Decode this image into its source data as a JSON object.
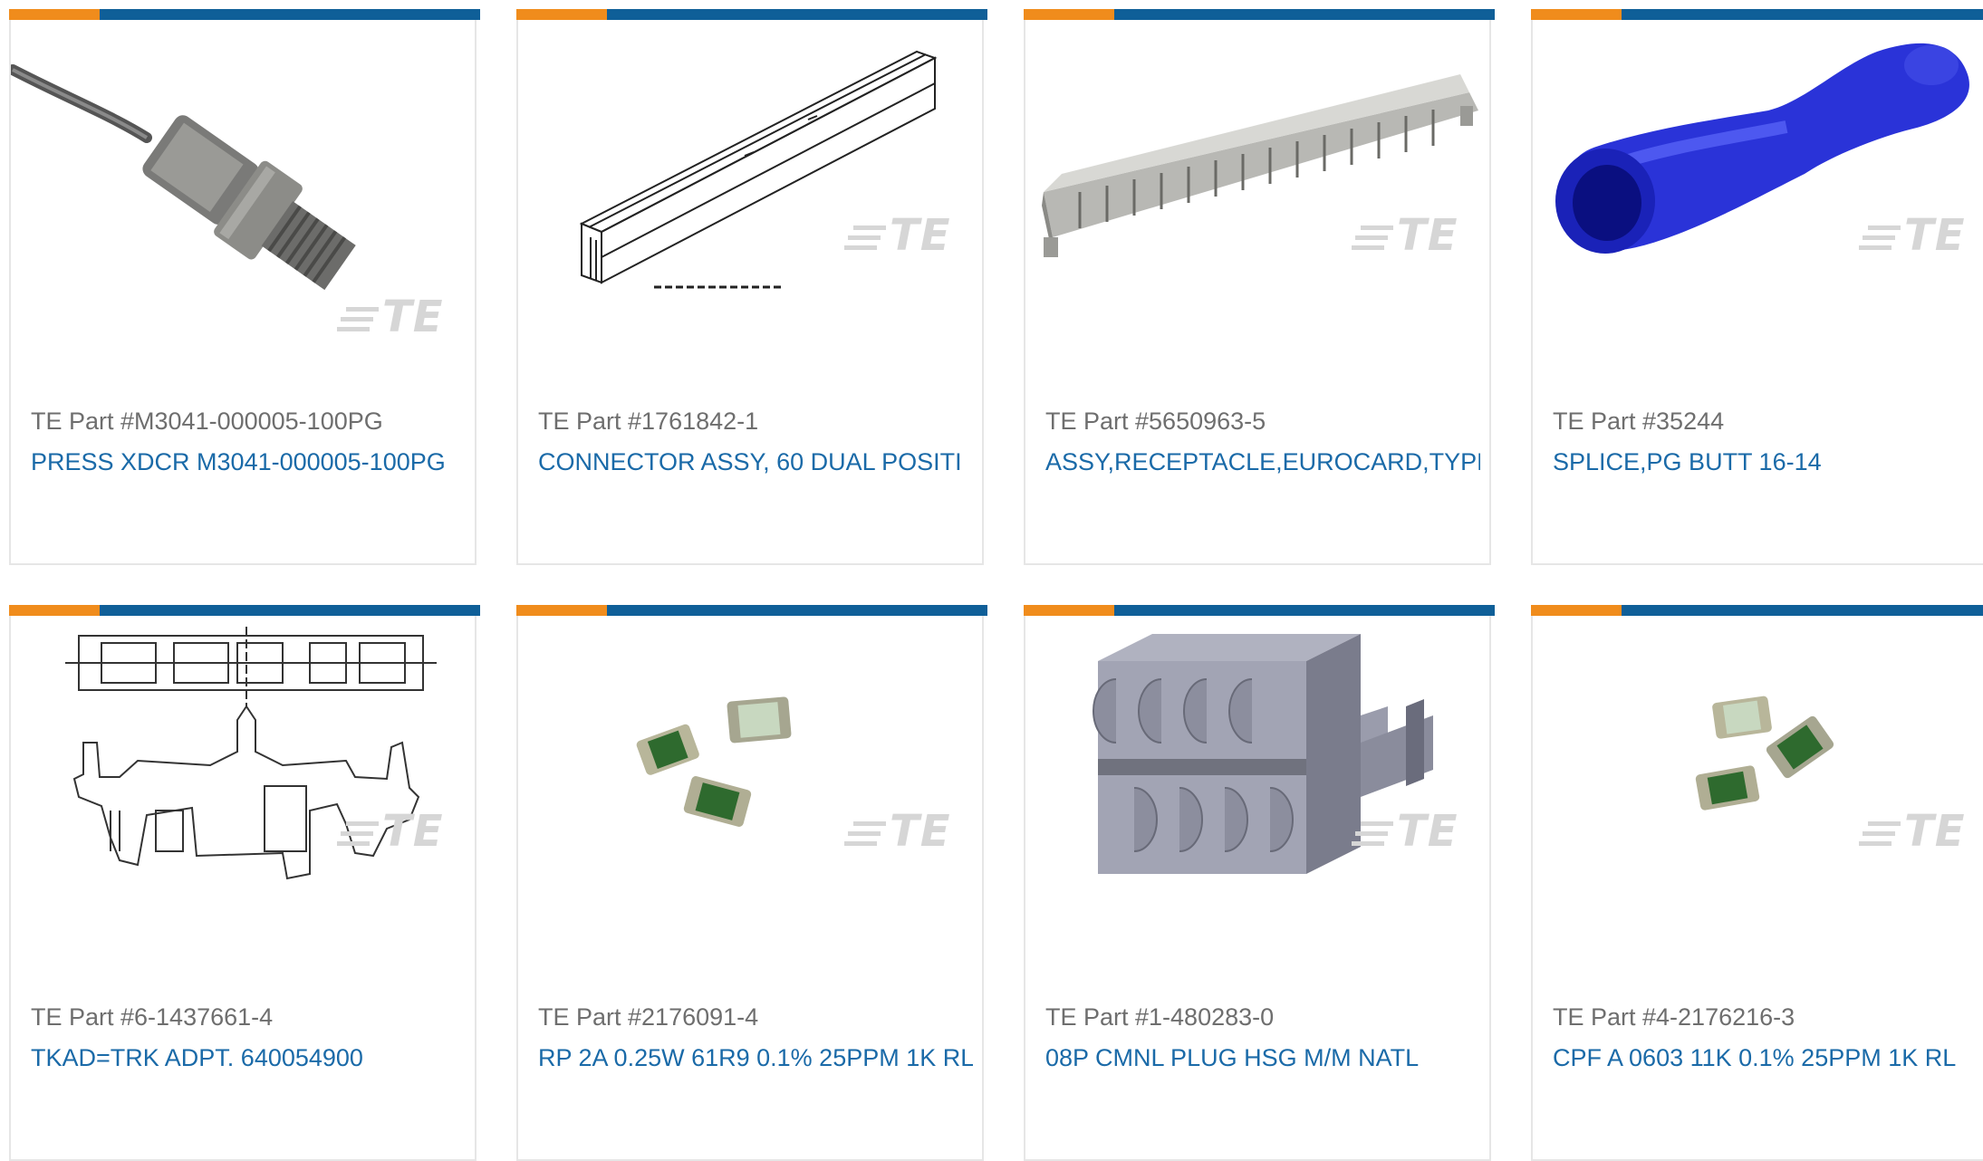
{
  "products": [
    {
      "part": "TE Part #M3041-000005-100PG",
      "desc": "PRESS XDCR M3041-000005-100PG",
      "image": "pressure-transducer"
    },
    {
      "part": "TE Part #1761842-1",
      "desc": "CONNECTOR ASSY, 60 DUAL POSITI",
      "image": "card-edge-connector"
    },
    {
      "part": "TE Part #5650963-5",
      "desc": "ASSY,RECEPTACLE,EUROCARD,TYPE",
      "image": "eurocard-receptacle"
    },
    {
      "part": "TE Part #35244",
      "desc": "SPLICE,PG BUTT 16-14",
      "image": "butt-splice"
    },
    {
      "part": "TE Part #6-1437661-4",
      "desc": "TKAD=TRK ADPT. 640054900",
      "image": "track-adapter-drawing"
    },
    {
      "part": "TE Part #2176091-4",
      "desc": "RP 2A 0.25W 61R9 0.1% 25PPM 1K RL",
      "image": "chip-resistors"
    },
    {
      "part": "TE Part #1-480283-0",
      "desc": "08P CMNL PLUG HSG M/M NATL",
      "image": "plug-housing"
    },
    {
      "part": "TE Part #4-2176216-3",
      "desc": "CPF A 0603 11K 0.1% 25PPM 1K RL",
      "image": "chip-resistors"
    }
  ],
  "watermark": "TE",
  "colors": {
    "accent": "#f08c1c",
    "brand": "#0f5f98",
    "link": "#1a6aa8",
    "muted": "#6e6e6e"
  }
}
